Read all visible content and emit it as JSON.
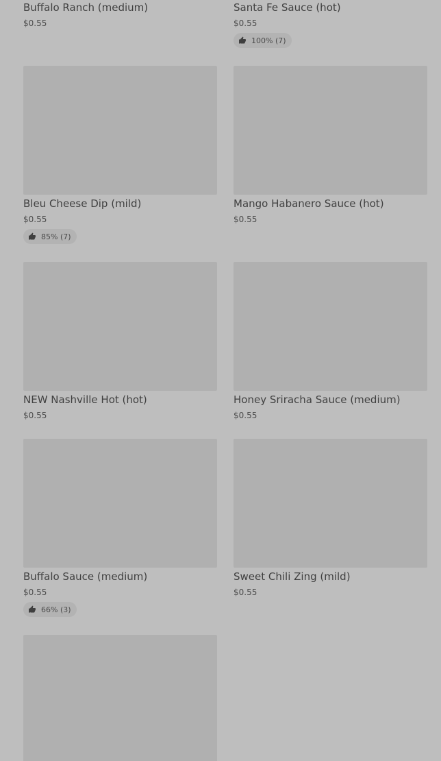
{
  "items": [
    {
      "name": "Buffalo Ranch (medium)",
      "price": "$0.55",
      "rating": ""
    },
    {
      "name": "Santa Fe Sauce (hot)",
      "price": "$0.55",
      "rating": "100% (7)"
    },
    {
      "name": "Bleu Cheese Dip (mild)",
      "price": "$0.55",
      "rating": "85% (7)"
    },
    {
      "name": "Mango Habanero Sauce (hot)",
      "price": "$0.55",
      "rating": ""
    },
    {
      "name": "NEW Nashville Hot (hot)",
      "price": "$0.55",
      "rating": ""
    },
    {
      "name": "Honey Sriracha Sauce (medium)",
      "price": "$0.55",
      "rating": ""
    },
    {
      "name": "Buffalo Sauce (medium)",
      "price": "$0.55",
      "rating": "66% (3)"
    },
    {
      "name": "Sweet Chili Zing (mild)",
      "price": "$0.55",
      "rating": ""
    }
  ],
  "icons": {
    "thumbs_up": "thumbs-up-icon"
  }
}
